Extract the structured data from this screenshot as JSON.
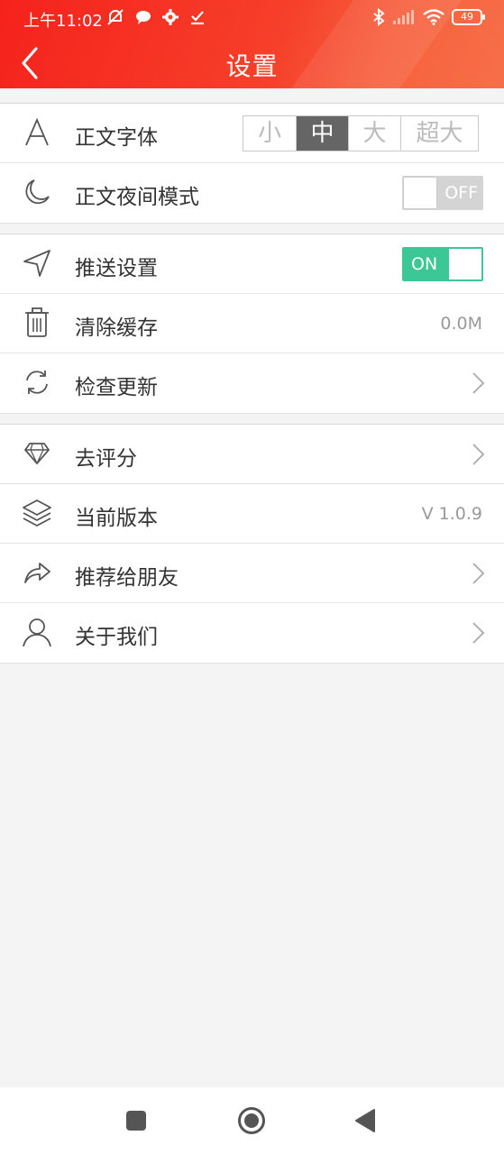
{
  "status_bar": {
    "time": "上午11:02",
    "battery": "49"
  },
  "header": {
    "title": "设置"
  },
  "sections": {
    "display": {
      "font": {
        "label": "正文字体",
        "options": [
          "小",
          "中",
          "大",
          "超大"
        ],
        "selected": "中"
      },
      "night_mode": {
        "label": "正文夜间模式",
        "state": "OFF"
      }
    },
    "general": {
      "push": {
        "label": "推送设置",
        "state": "ON"
      },
      "cache": {
        "label": "清除缓存",
        "value": "0.0M"
      },
      "update": {
        "label": "检查更新"
      }
    },
    "about": {
      "rate": {
        "label": "去评分"
      },
      "version": {
        "label": "当前版本",
        "value": "V 1.0.9"
      },
      "share": {
        "label": "推荐给朋友"
      },
      "about_us": {
        "label": "关于我们"
      }
    }
  },
  "icons": {
    "font": "font-icon",
    "night": "moon-icon",
    "push": "send-icon",
    "cache": "trash-icon",
    "update": "refresh-icon",
    "rate": "diamond-icon",
    "version": "layers-icon",
    "share": "share-icon",
    "about": "user-icon"
  },
  "colors": {
    "header_start": "#f5221c",
    "header_end": "#f66f48",
    "toggle_on": "#3bc796",
    "toggle_off": "#d4d4d4",
    "segment_active": "#656565"
  }
}
